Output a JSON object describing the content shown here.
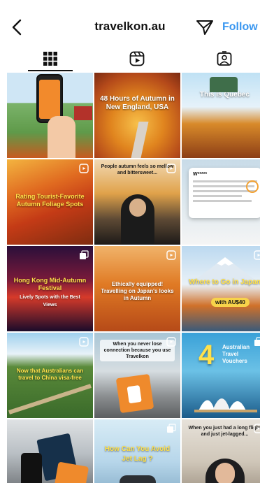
{
  "header": {
    "username": "travelkon.au",
    "follow_label": "Follow"
  },
  "tabs": [
    {
      "name": "grid",
      "icon": "grid-icon",
      "active": true
    },
    {
      "name": "reels",
      "icon": "reels-icon",
      "active": false
    },
    {
      "name": "tagged",
      "icon": "tagged-icon",
      "active": false
    }
  ],
  "colors": {
    "accent": "#3a97f0",
    "text": "#111111"
  },
  "posts": [
    {
      "caption": "",
      "type": "image"
    },
    {
      "caption": "48 Hours of Autumn in New England, USA",
      "type": "image"
    },
    {
      "caption": "This is Quebec",
      "type": "image"
    },
    {
      "caption": "Rating Tourist-Favorite Autumn Foliage Spots",
      "type": "reel"
    },
    {
      "caption": "People autumn feels so mellow and bittersweet...",
      "type": "reel"
    },
    {
      "caption": "W*****",
      "type": "image"
    },
    {
      "caption": "Hong Kong Mid-Autumn Festival",
      "subcaption": "Lively Spots with the Best Views",
      "type": "multi"
    },
    {
      "caption": "Ethically equipped! Travelling on Japan's looks in Autumn",
      "type": "reel"
    },
    {
      "caption": "Where to Go in Japan",
      "subcaption": "with AU$40",
      "type": "reel"
    },
    {
      "caption": "Now that Australians can travel to China visa-free",
      "type": "reel"
    },
    {
      "caption": "When you never lose connection because you use Travelkon",
      "type": "reel"
    },
    {
      "caption": "4",
      "subcaption": "Australian Travel Vouchers",
      "type": "multi"
    },
    {
      "caption": "",
      "type": "image"
    },
    {
      "caption": "How Can You Avoid Jet Lag ?",
      "type": "multi"
    },
    {
      "caption": "When you just had a long flight and just jet-lagged...",
      "type": "reel"
    }
  ]
}
